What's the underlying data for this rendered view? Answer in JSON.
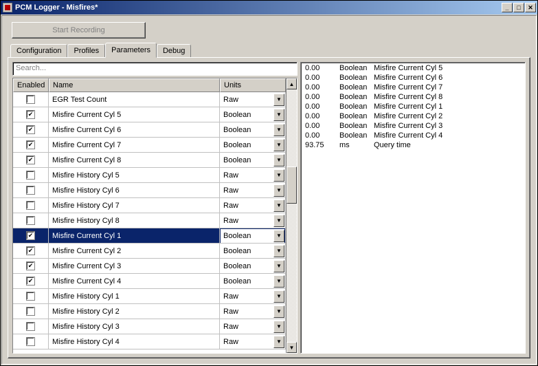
{
  "window": {
    "title": "PCM Logger - Misfires*"
  },
  "toolbar": {
    "start_recording": "Start Recording"
  },
  "tabs": [
    "Configuration",
    "Profiles",
    "Parameters",
    "Debug"
  ],
  "active_tab": 2,
  "search": {
    "placeholder": "Search..."
  },
  "grid": {
    "headers": {
      "enabled": "Enabled",
      "name": "Name",
      "units": "Units"
    },
    "rows": [
      {
        "enabled": false,
        "name": "EGR Test Count",
        "units": "Raw",
        "selected": false
      },
      {
        "enabled": true,
        "name": "Misfire Current Cyl 5",
        "units": "Boolean",
        "selected": false
      },
      {
        "enabled": true,
        "name": "Misfire Current Cyl 6",
        "units": "Boolean",
        "selected": false
      },
      {
        "enabled": true,
        "name": "Misfire Current Cyl 7",
        "units": "Boolean",
        "selected": false
      },
      {
        "enabled": true,
        "name": "Misfire Current Cyl 8",
        "units": "Boolean",
        "selected": false
      },
      {
        "enabled": false,
        "name": "Misfire History Cyl 5",
        "units": "Raw",
        "selected": false
      },
      {
        "enabled": false,
        "name": "Misfire History Cyl 6",
        "units": "Raw",
        "selected": false
      },
      {
        "enabled": false,
        "name": "Misfire History Cyl 7",
        "units": "Raw",
        "selected": false
      },
      {
        "enabled": false,
        "name": "Misfire History Cyl 8",
        "units": "Raw",
        "selected": false
      },
      {
        "enabled": true,
        "name": "Misfire Current Cyl 1",
        "units": "Boolean",
        "selected": true
      },
      {
        "enabled": true,
        "name": "Misfire Current Cyl 2",
        "units": "Boolean",
        "selected": false
      },
      {
        "enabled": true,
        "name": "Misfire Current Cyl 3",
        "units": "Boolean",
        "selected": false
      },
      {
        "enabled": true,
        "name": "Misfire Current Cyl 4",
        "units": "Boolean",
        "selected": false
      },
      {
        "enabled": false,
        "name": "Misfire History Cyl 1",
        "units": "Raw",
        "selected": false
      },
      {
        "enabled": false,
        "name": "Misfire History Cyl 2",
        "units": "Raw",
        "selected": false
      },
      {
        "enabled": false,
        "name": "Misfire History Cyl 3",
        "units": "Raw",
        "selected": false
      },
      {
        "enabled": false,
        "name": "Misfire History Cyl 4",
        "units": "Raw",
        "selected": false
      }
    ]
  },
  "log": [
    {
      "value": "0.00",
      "type": "Boolean",
      "name": "Misfire Current Cyl 5"
    },
    {
      "value": "0.00",
      "type": "Boolean",
      "name": "Misfire Current Cyl 6"
    },
    {
      "value": "0.00",
      "type": "Boolean",
      "name": "Misfire Current Cyl 7"
    },
    {
      "value": "0.00",
      "type": "Boolean",
      "name": "Misfire Current Cyl 8"
    },
    {
      "value": "0.00",
      "type": "Boolean",
      "name": "Misfire Current Cyl 1"
    },
    {
      "value": "0.00",
      "type": "Boolean",
      "name": "Misfire Current Cyl 2"
    },
    {
      "value": "0.00",
      "type": "Boolean",
      "name": "Misfire Current Cyl 3"
    },
    {
      "value": "0.00",
      "type": "Boolean",
      "name": "Misfire Current Cyl 4"
    },
    {
      "value": "93.75",
      "type": "ms",
      "name": "Query time"
    }
  ]
}
